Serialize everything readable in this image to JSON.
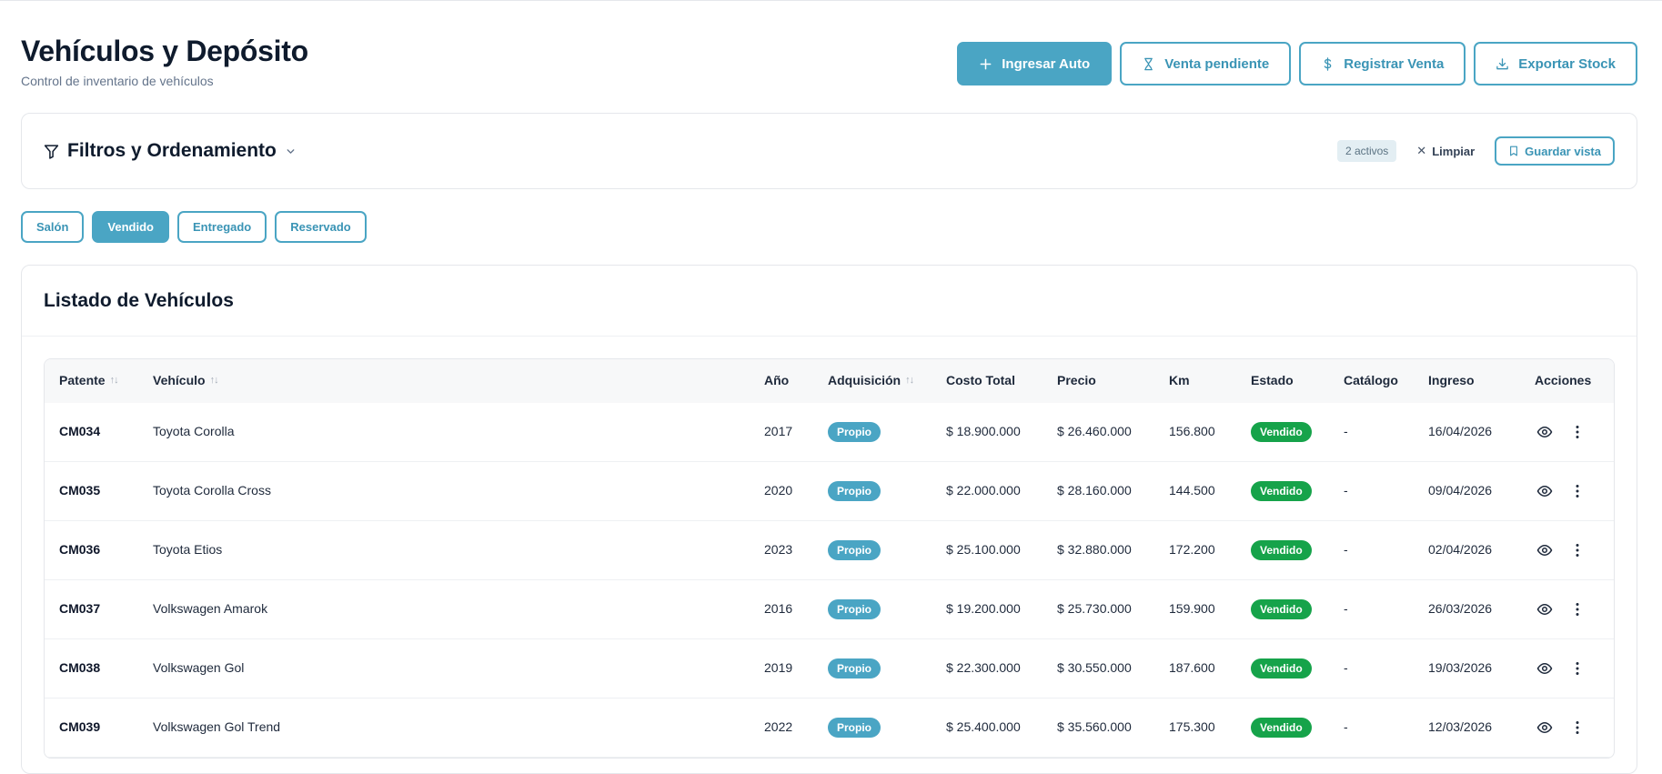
{
  "header": {
    "title": "Vehículos y Depósito",
    "subtitle": "Control de inventario de vehículos"
  },
  "actions": {
    "add_car": "Ingresar Auto",
    "pending_sale": "Venta pendiente",
    "register_sale": "Registrar Venta",
    "export_stock": "Exportar Stock"
  },
  "filters": {
    "title": "Filtros y Ordenamiento",
    "active_badge": "2 activos",
    "clear": "Limpiar",
    "save_view": "Guardar vista"
  },
  "status_chips": [
    {
      "label": "Salón",
      "active": false
    },
    {
      "label": "Vendido",
      "active": true
    },
    {
      "label": "Entregado",
      "active": false
    },
    {
      "label": "Reservado",
      "active": false
    }
  ],
  "list": {
    "title": "Listado de Vehículos",
    "columns": {
      "patente": "Patente",
      "vehiculo": "Vehículo",
      "anio": "Año",
      "adquisicion": "Adquisición",
      "costo": "Costo Total",
      "precio": "Precio",
      "km": "Km",
      "estado": "Estado",
      "catalogo": "Catálogo",
      "ingreso": "Ingreso",
      "acciones": "Acciones"
    },
    "rows": [
      {
        "patente": "CM034",
        "vehiculo": "Toyota Corolla",
        "anio": "2017",
        "adquisicion": "Propio",
        "costo": "$ 18.900.000",
        "precio": "$ 26.460.000",
        "km": "156.800",
        "estado": "Vendido",
        "catalogo": "-",
        "ingreso": "16/04/2026"
      },
      {
        "patente": "CM035",
        "vehiculo": "Toyota Corolla Cross",
        "anio": "2020",
        "adquisicion": "Propio",
        "costo": "$ 22.000.000",
        "precio": "$ 28.160.000",
        "km": "144.500",
        "estado": "Vendido",
        "catalogo": "-",
        "ingreso": "09/04/2026"
      },
      {
        "patente": "CM036",
        "vehiculo": "Toyota Etios",
        "anio": "2023",
        "adquisicion": "Propio",
        "costo": "$ 25.100.000",
        "precio": "$ 32.880.000",
        "km": "172.200",
        "estado": "Vendido",
        "catalogo": "-",
        "ingreso": "02/04/2026"
      },
      {
        "patente": "CM037",
        "vehiculo": "Volkswagen Amarok",
        "anio": "2016",
        "adquisicion": "Propio",
        "costo": "$ 19.200.000",
        "precio": "$ 25.730.000",
        "km": "159.900",
        "estado": "Vendido",
        "catalogo": "-",
        "ingreso": "26/03/2026"
      },
      {
        "patente": "CM038",
        "vehiculo": "Volkswagen Gol",
        "anio": "2019",
        "adquisicion": "Propio",
        "costo": "$ 22.300.000",
        "precio": "$ 30.550.000",
        "km": "187.600",
        "estado": "Vendido",
        "catalogo": "-",
        "ingreso": "19/03/2026"
      },
      {
        "patente": "CM039",
        "vehiculo": "Volkswagen Gol Trend",
        "anio": "2022",
        "adquisicion": "Propio",
        "costo": "$ 25.400.000",
        "precio": "$ 35.560.000",
        "km": "175.300",
        "estado": "Vendido",
        "catalogo": "-",
        "ingreso": "12/03/2026"
      }
    ]
  },
  "colors": {
    "accent": "#4aa5c4",
    "success": "#16a34a"
  }
}
